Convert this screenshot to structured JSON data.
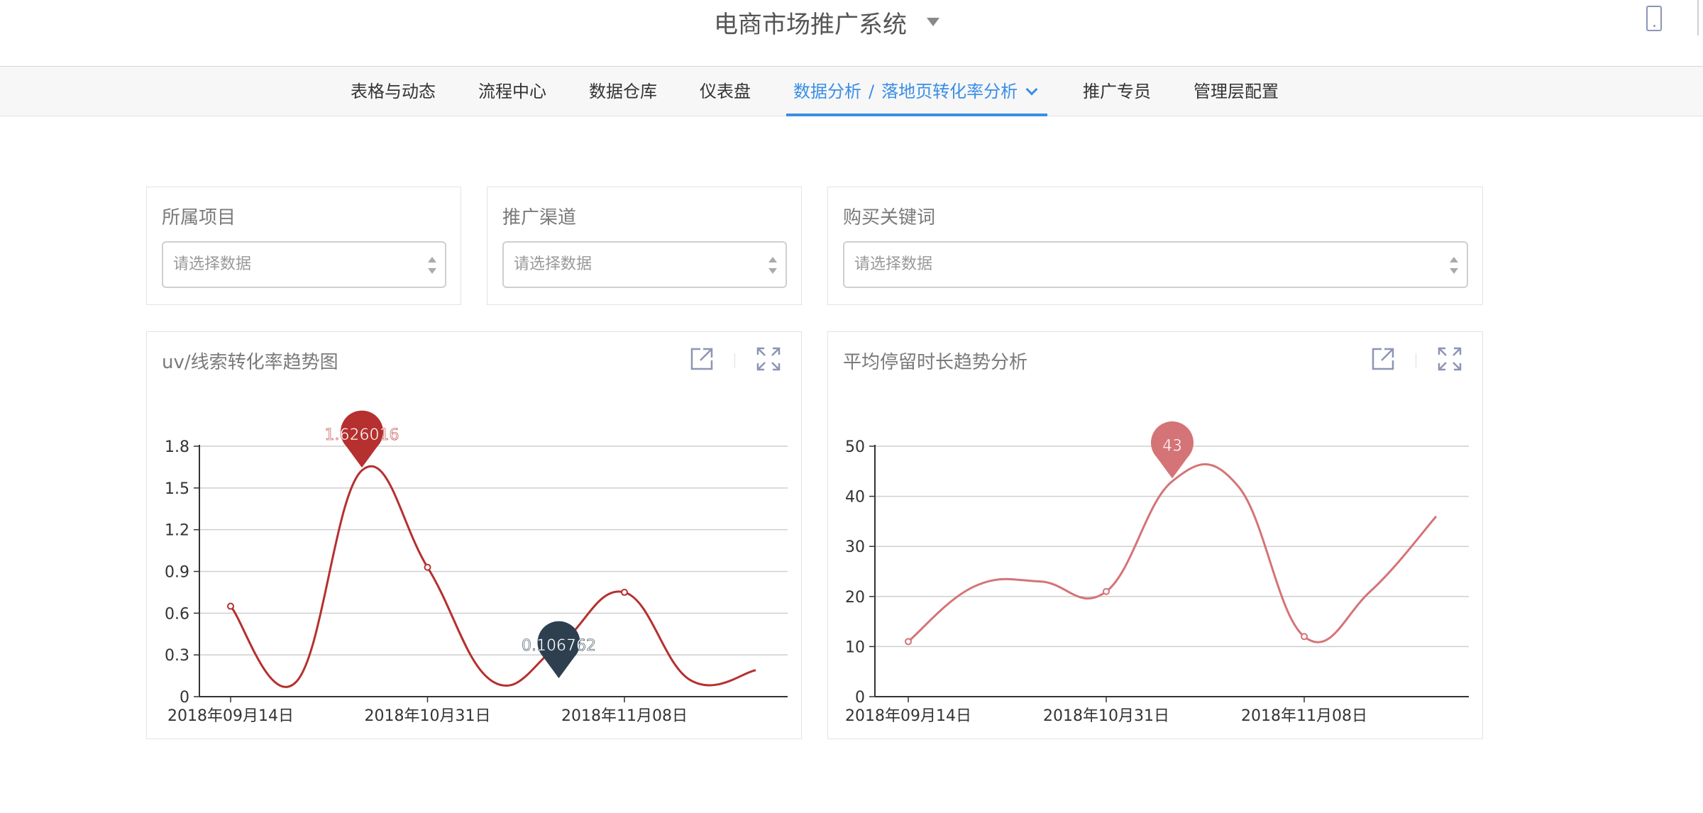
{
  "header": {
    "title": "电商市场推广系统"
  },
  "nav": {
    "items": [
      "表格与动态",
      "流程中心",
      "数据仓库",
      "仪表盘"
    ],
    "active_parent": "数据分析",
    "active_separator": "/",
    "active_child": "落地页转化率分析",
    "items_after": [
      "推广专员",
      "管理层配置"
    ]
  },
  "filters": [
    {
      "label": "所属项目",
      "placeholder": "请选择数据"
    },
    {
      "label": "推广渠道",
      "placeholder": "请选择数据"
    },
    {
      "label": "购买关键词",
      "placeholder": "请选择数据"
    }
  ],
  "colors": {
    "accent": "#3a8ee6",
    "series1": "#b5302f",
    "series2": "#d47477",
    "min_pin": "#2e4050"
  },
  "chart_data": [
    {
      "type": "line",
      "title": "uv/线索转化率趋势图",
      "x_ticks": [
        "2018年09月14日",
        "2018年10月31日",
        "2018年11月08日"
      ],
      "y_ticks": [
        "0",
        "0.3",
        "0.6",
        "0.9",
        "1.2",
        "1.5",
        "1.8"
      ],
      "ylim": [
        0,
        1.8
      ],
      "series": [
        {
          "values": [
            0.65,
            0.106762,
            1.626016,
            0.93,
            0.106762,
            0.37,
            0.75,
            0.12,
            0.19
          ]
        }
      ],
      "mark_max": {
        "label": "1.626016",
        "value": 1.626016,
        "index": 2
      },
      "mark_min": {
        "label": "0.106762",
        "value": 0.106762,
        "index": 5
      },
      "grid": true,
      "toolbox": [
        "open-external",
        "fullscreen"
      ]
    },
    {
      "type": "line",
      "title": "平均停留时长趋势分析",
      "x_ticks": [
        "2018年09月14日",
        "2018年10月31日",
        "2018年11月08日"
      ],
      "y_ticks": [
        "0",
        "10",
        "20",
        "30",
        "40",
        "50"
      ],
      "ylim": [
        0,
        50
      ],
      "series": [
        {
          "values": [
            11,
            22,
            23,
            21,
            43,
            42,
            12,
            21,
            36
          ]
        }
      ],
      "mark_max": {
        "label": "43",
        "value": 43,
        "index": 4
      },
      "grid": true,
      "toolbox": [
        "open-external",
        "fullscreen"
      ]
    }
  ]
}
